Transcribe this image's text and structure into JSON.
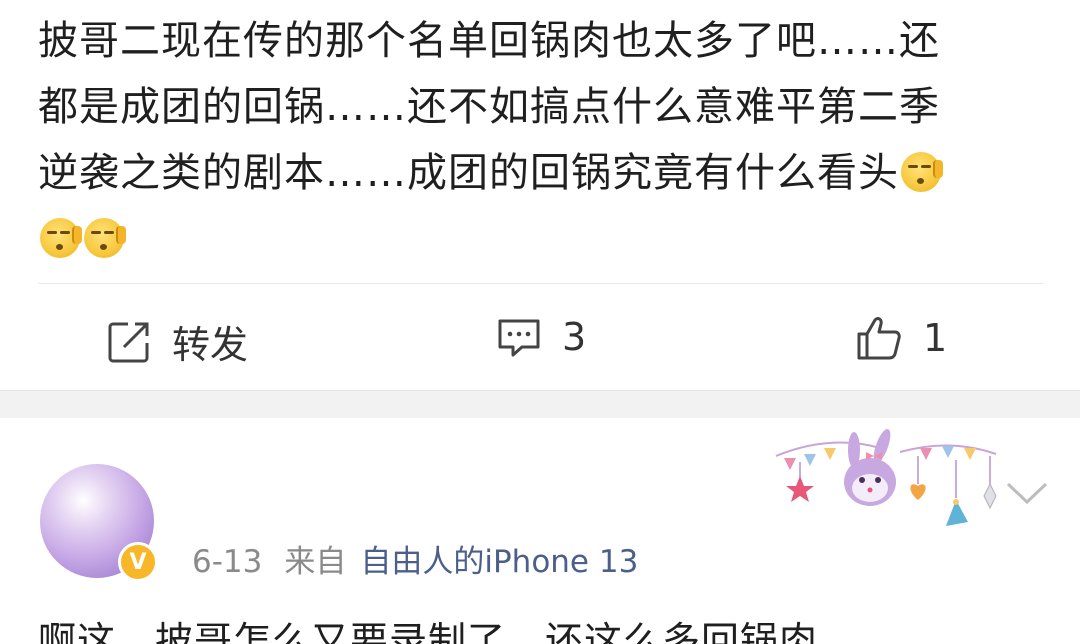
{
  "post": {
    "text_line1": "披哥二现在传的那个名单回锅肉也太多了吧……还",
    "text_line2": "都是成团的回锅……还不如搞点什么意难平第二季",
    "text_line3": "逆袭之类的剧本……成团的回锅究竟有什么看头",
    "emoji_icon": "face-with-hand-emoji"
  },
  "actions": {
    "share_label": "转发",
    "comment_count": "3",
    "like_count": "1"
  },
  "comment": {
    "date": "6-13",
    "from_label": "来自",
    "device": "自由人的iPhone 13",
    "verified_badge": "V",
    "text": "啊这，披哥怎么又要录制了，还这么多回锅肉"
  },
  "colors": {
    "accent_link": "#4c5f8a",
    "badge": "#f7b728",
    "meta_gray": "#8a8a8a"
  }
}
